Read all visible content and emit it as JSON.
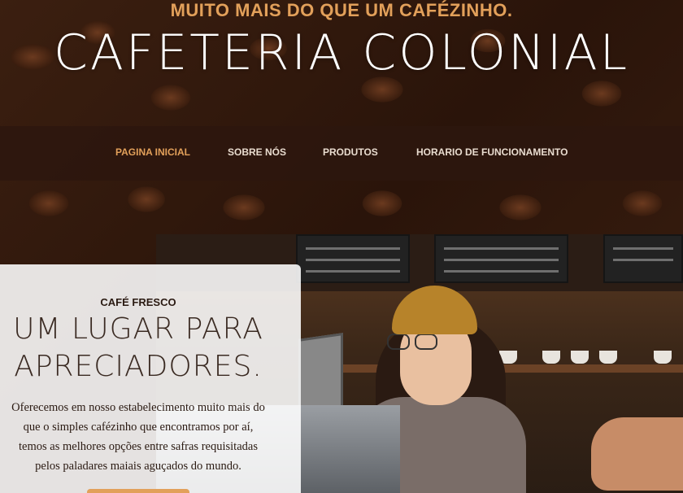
{
  "header": {
    "tagline": "MUITO MAIS DO QUE UM CAFÉZINHO.",
    "brand": "CAFETERIA COLONIAL"
  },
  "nav": {
    "items": [
      {
        "label": "PAGINA INICIAL",
        "active": true
      },
      {
        "label": "SOBRE NÓS",
        "active": false
      },
      {
        "label": "PRODUTOS",
        "active": false
      },
      {
        "label": "HORARIO DE FUNCIONAMENTO",
        "active": false
      }
    ]
  },
  "intro": {
    "eyebrow": "CAFÉ FRESCO",
    "headline_line1": "UM LUGAR PARA",
    "headline_line2": "APRECIADORES.",
    "body_lines": [
      "Oferecemos em nosso estabelecimento muito mais do",
      "que o simples cafézinho que encontramos por aí,",
      "temos as melhores opções entre safras requisitadas",
      "pelos paladares maiais aguçados do mundo."
    ]
  },
  "colors": {
    "accent": "#e2a05a",
    "nav_bg": "#2d160e",
    "text_dark": "#2a1a12"
  }
}
